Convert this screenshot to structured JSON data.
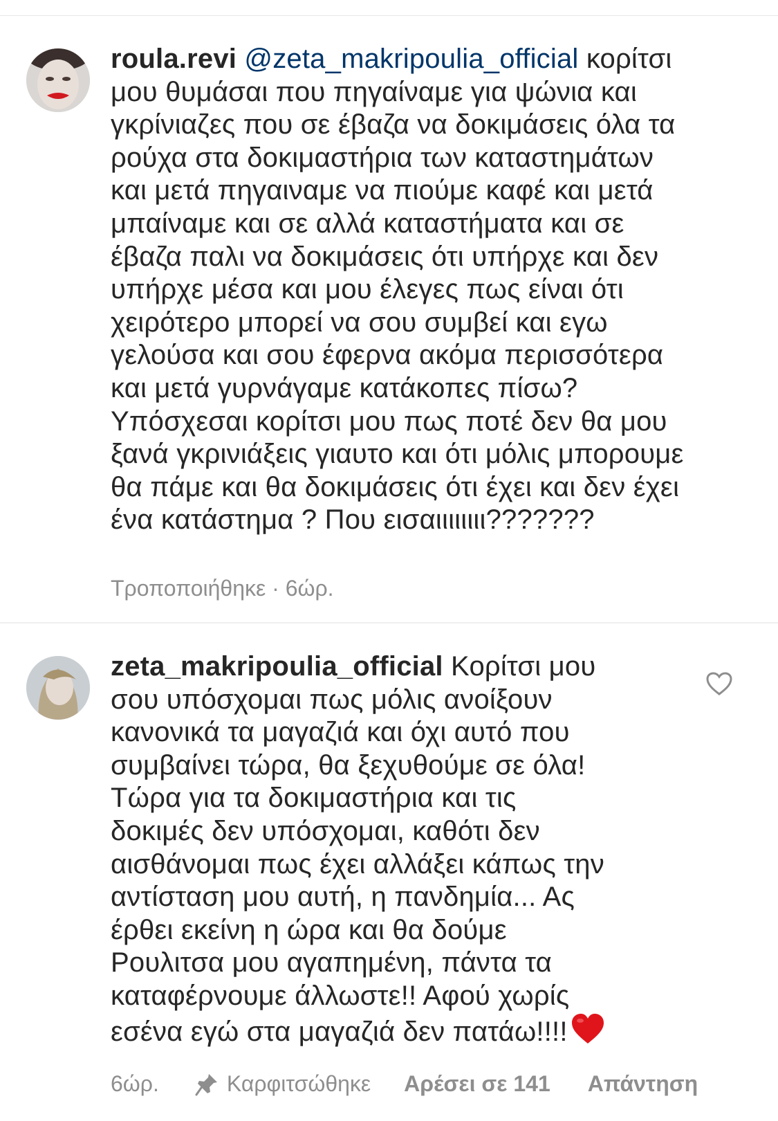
{
  "comments": [
    {
      "username": "roula.revi",
      "mention": "@zeta_makripoulia_official",
      "text": " κορίτσι\nμου θυμάσαι που πηγαίναμε για ψώνια και\nγκρίνιαζες  που σε έβαζα να δοκιμάσεις όλα τα\nρούχα στα δοκιμαστήρια  των καταστημάτων\nκαι μετά πηγαιναμε να πιούμε καφέ και μετά\nμπαίναμε και σε αλλά καταστήματα και σε\nέβαζα παλι να δοκιμάσεις ότι υπήρχε και δεν\nυπήρχε μέσα και μου έλεγες πως είναι  ότι\nχειρότερο μπορεί  να σου συμβεί και εγω\nγελούσα και σου έφερνα ακόμα περισσότερα\nκαι μετά γυρνάγαμε κατάκοπες πίσω?\nΥπόσχεσαι κορίτσι μου πως ποτέ δεν θα μου\nξανά γκρινιάξεις γιαυτο και ότι μόλις μπορουμε\nθα πάμε και θα δοκιμάσεις ότι έχει και δεν έχει\nένα κατάστημα ? Που εισαιιιιιιιι???????",
      "meta": "Τροποποιήθηκε · 6ώρ."
    },
    {
      "username": "zeta_makripoulia_official",
      "text": " Κορίτσι μου\nσου υπόσχομαι πως μόλις ανοίξουν\nκανονικά τα μαγαζιά και όχι αυτό που\nσυμβαίνει τώρα, θα ξεχυθούμε σε όλα!\nΤώρα για τα δοκιμαστήρια και τις\nδοκιμές δεν υπόσχομαι, καθότι δεν\nαισθάνομαι πως έχει αλλάξει κάπως την\nαντίσταση μου αυτή, η πανδημία... Ας\nέρθει εκείνη η ώρα και θα δούμε\nΡουλιτσα μου αγαπημένη, πάντα τα\nκαταφέρνουμε άλλωστε!! Αφού χωρίς\nεσένα εγώ στα μαγαζιά δεν πατάω!!!!",
      "time": "6ώρ.",
      "pinned_label": "Καρφιτσώθηκε",
      "likes_label": "Αρέσει σε 141",
      "reply_label": "Απάντηση",
      "heart_icon": "like-heart-icon",
      "emoji": "red-heart-emoji"
    }
  ]
}
